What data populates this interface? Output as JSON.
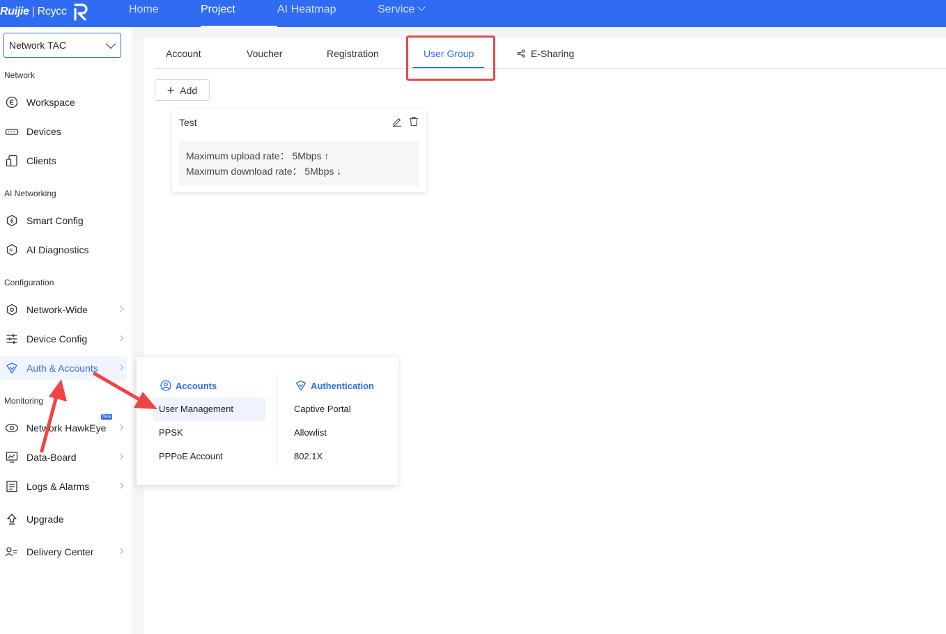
{
  "brand": {
    "name": "Ruijie",
    "product": "Rcycc"
  },
  "top_nav": [
    {
      "label": "Home",
      "active": false
    },
    {
      "label": "Project",
      "active": true
    },
    {
      "label": "AI Heatmap",
      "active": false
    },
    {
      "label": "Service",
      "active": false,
      "dropdown": true
    }
  ],
  "sidebar": {
    "project": "Network TAC",
    "sections": {
      "network": "Network",
      "ai_networking": "AI Networking",
      "configuration": "Configuration",
      "monitoring": "Monitoring"
    },
    "items": {
      "workspace": "Workspace",
      "devices": "Devices",
      "clients": "Clients",
      "smart_config": "Smart Config",
      "ai_diagnostics": "AI Diagnostics",
      "network_wide": "Network-Wide",
      "device_config": "Device Config",
      "auth_accounts": "Auth & Accounts",
      "network_hawkeye": "Network HawkEye",
      "data_board": "Data-Board",
      "logs_alarms": "Logs & Alarms",
      "upgrade": "Upgrade",
      "delivery_center": "Delivery Center"
    },
    "beta_badge": "Beta"
  },
  "tabs": [
    {
      "label": "Account"
    },
    {
      "label": "Voucher"
    },
    {
      "label": "Registration"
    },
    {
      "label": "User Group",
      "active": true
    },
    {
      "label": "E-Sharing"
    }
  ],
  "add_button": "Add",
  "user_group_card": {
    "name": "Test",
    "upload_line": "Maximum upload rate： 5Mbps ↑",
    "download_line": "Maximum download rate： 5Mbps ↓"
  },
  "flyout": {
    "accounts_heading": "Accounts",
    "accounts_items": [
      "User Management",
      "PPSK",
      "PPPoE Account"
    ],
    "auth_heading": "Authentication",
    "auth_items": [
      "Captive Portal",
      "Allowlist",
      "802.1X"
    ]
  },
  "colors": {
    "primary": "#2f6cf2",
    "annotation": "#e24b4b"
  }
}
